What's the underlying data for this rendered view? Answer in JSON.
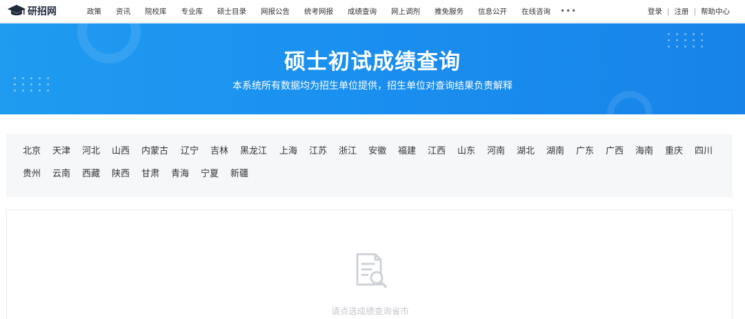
{
  "header": {
    "logo_text": "研招网",
    "nav": [
      "政策",
      "资讯",
      "院校库",
      "专业库",
      "硕士目录",
      "网报公告",
      "统考网报",
      "成绩查询",
      "网上调剂",
      "推免服务",
      "信息公开",
      "在线咨询"
    ],
    "more": "•••",
    "login": "登录",
    "register": "注册",
    "help": "帮助中心"
  },
  "banner": {
    "title": "硕士初试成绩查询",
    "subtitle": "本系统所有数据均为招生单位提供，招生单位对查询结果负责解释"
  },
  "provinces": [
    "北京",
    "天津",
    "河北",
    "山西",
    "内蒙古",
    "辽宁",
    "吉林",
    "黑龙江",
    "上海",
    "江苏",
    "浙江",
    "安徽",
    "福建",
    "江西",
    "山东",
    "河南",
    "湖北",
    "湖南",
    "广东",
    "广西",
    "海南",
    "重庆",
    "四川",
    "贵州",
    "云南",
    "西藏",
    "陕西",
    "甘肃",
    "青海",
    "宁夏",
    "新疆"
  ],
  "empty_state": {
    "icon": "document-search-icon",
    "message": "请点选成绩查询省市"
  },
  "colors": {
    "banner": "#1a8ff0",
    "panel_bg": "#f6f7f9",
    "muted_text": "#c4c7cc"
  }
}
